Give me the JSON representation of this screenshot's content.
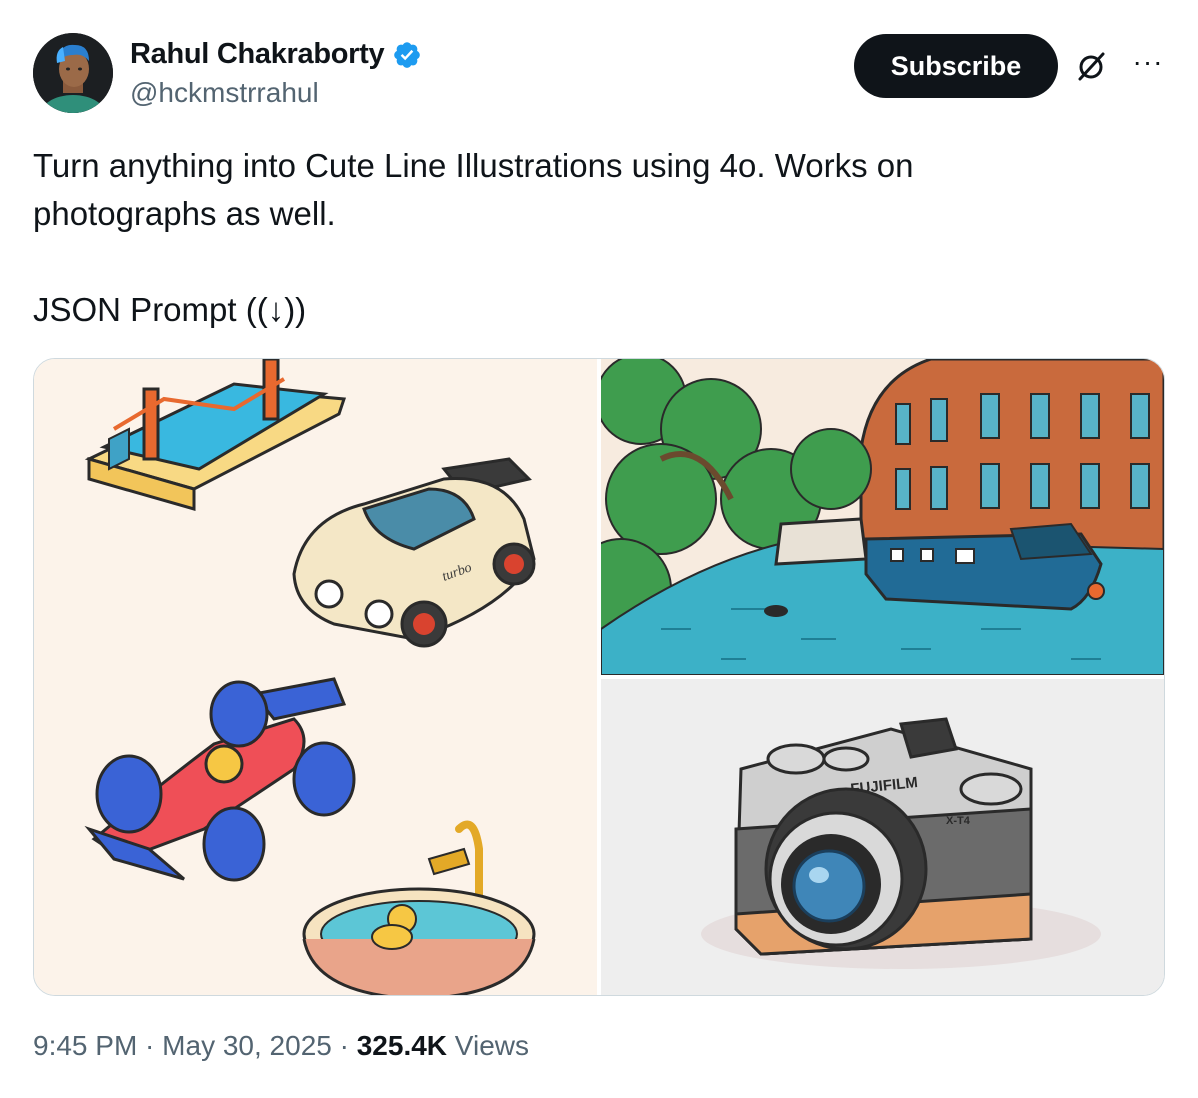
{
  "author": {
    "display_name": "Rahul Chakraborty",
    "handle": "@hckmstrrahul",
    "verified_color": "#1d9bf0"
  },
  "actions": {
    "subscribe_label": "Subscribe",
    "grok_icon": "grok-icon",
    "more_icon": "more-options-icon",
    "more_label": "···"
  },
  "tweet": {
    "line1": "Turn anything into Cute Line Illustrations using 4o. Works on",
    "line2": "photographs as well.",
    "line3": "JSON Prompt ((↓))"
  },
  "media": {
    "camera_brand": "FUJIFILM",
    "camera_model": "X-T4",
    "car_label": "turbo"
  },
  "meta": {
    "time": "9:45 PM",
    "separator": " · ",
    "date": "May 30, 2025",
    "views_count": "325.4K",
    "views_label": " Views"
  },
  "colors": {
    "text_primary": "#0f1419",
    "text_secondary": "#536471",
    "border": "#cfd9de"
  }
}
